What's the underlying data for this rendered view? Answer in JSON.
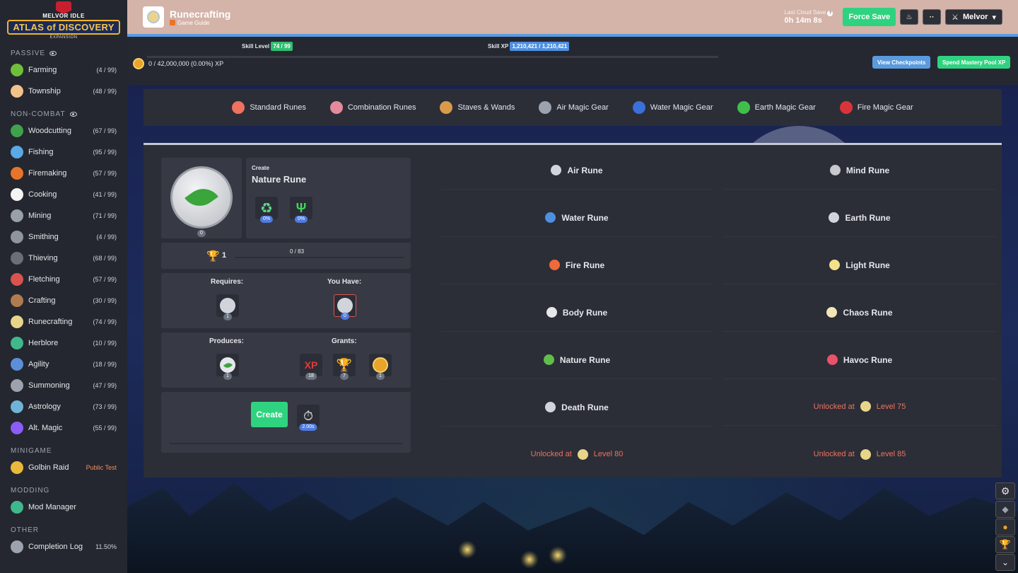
{
  "sidebar": {
    "logo": {
      "top": "MELVOR IDLE",
      "main": "ATLAS of DISCOVERY",
      "sub": "EXPANSION"
    },
    "sections": {
      "passive": "PASSIVE",
      "noncombat": "NON-COMBAT",
      "minigame": "MINIGAME",
      "modding": "MODDING",
      "other": "OTHER"
    },
    "passive_items": [
      {
        "name": "Farming",
        "level": "(4 / 99)",
        "color": "#6fbf3b"
      },
      {
        "name": "Township",
        "level": "(48 / 99)",
        "color": "#f2c28b"
      }
    ],
    "noncombat_items": [
      {
        "name": "Woodcutting",
        "level": "(67 / 99)",
        "color": "#3fa34d"
      },
      {
        "name": "Fishing",
        "level": "(95 / 99)",
        "color": "#5aa9e6"
      },
      {
        "name": "Firemaking",
        "level": "(57 / 99)",
        "color": "#e8742a"
      },
      {
        "name": "Cooking",
        "level": "(41 / 99)",
        "color": "#f4f4f4"
      },
      {
        "name": "Mining",
        "level": "(71 / 99)",
        "color": "#9aa0a8"
      },
      {
        "name": "Smithing",
        "level": "(4 / 99)",
        "color": "#8f959e"
      },
      {
        "name": "Thieving",
        "level": "(68 / 99)",
        "color": "#6b6e78"
      },
      {
        "name": "Fletching",
        "level": "(57 / 99)",
        "color": "#d9534f"
      },
      {
        "name": "Crafting",
        "level": "(30 / 99)",
        "color": "#b07c4f"
      },
      {
        "name": "Runecrafting",
        "level": "(74 / 99)",
        "color": "#e9d58a"
      },
      {
        "name": "Herblore",
        "level": "(10 / 99)",
        "color": "#3fb88c"
      },
      {
        "name": "Agility",
        "level": "(18 / 99)",
        "color": "#5b8fd9"
      },
      {
        "name": "Summoning",
        "level": "(47 / 99)",
        "color": "#9ca3af"
      },
      {
        "name": "Astrology",
        "level": "(73 / 99)",
        "color": "#6fb3d9"
      },
      {
        "name": "Alt. Magic",
        "level": "(55 / 99)",
        "color": "#8b5cf6"
      }
    ],
    "minigame_item": {
      "name": "Golbin Raid",
      "tag": "Public Test"
    },
    "modding_item": {
      "name": "Mod Manager"
    },
    "other_item": {
      "name": "Completion Log",
      "value": "11.50%"
    }
  },
  "header": {
    "title": "Runecrafting",
    "guide": "Game Guide",
    "cloud_label": "Last Cloud Save",
    "cloud_time": "0h 14m 8s",
    "force_save": "Force Save",
    "dots": "··",
    "user": "Melvor"
  },
  "xp": {
    "skill_level_label": "Skill Level",
    "skill_level": "74 / 99",
    "skill_xp_label": "Skill XP",
    "skill_xp": "1,210,421 / 1,210,421",
    "mastery_pool": "0 / 42,000,000 (0.00%) XP",
    "view_checkpoints": "View Checkpoints",
    "spend_mastery": "Spend Mastery Pool XP"
  },
  "tabs": [
    {
      "label": "Standard Runes",
      "color": "#f0715f"
    },
    {
      "label": "Combination Runes",
      "color": "#e58a9c"
    },
    {
      "label": "Staves & Wands",
      "color": "#d99b4a"
    },
    {
      "label": "Air Magic Gear",
      "color": "#9ca3af"
    },
    {
      "label": "Water Magic Gear",
      "color": "#3b6fd9"
    },
    {
      "label": "Earth Magic Gear",
      "color": "#3fbf4a"
    },
    {
      "label": "Fire Magic Gear",
      "color": "#d9343a"
    }
  ],
  "create": {
    "heading": "Create",
    "item": "Nature Rune",
    "item_count": "0",
    "mod1": "0%",
    "mod2": "0%",
    "mastery_level": "1",
    "mastery_progress": "0 / 83",
    "requires": "Requires:",
    "you_have": "You Have:",
    "req_count": "1",
    "have_count": "0",
    "produces": "Produces:",
    "grants": "Grants:",
    "prod_count": "1",
    "xp_text": "XP",
    "xp_count": "18",
    "trophy_count": "7",
    "pool_count": "1",
    "create_btn": "Create",
    "time": "2.00s"
  },
  "runes_left": [
    {
      "name": "Air Rune",
      "color": "#d1d5db"
    },
    {
      "name": "Water Rune",
      "color": "#4f8fe0"
    },
    {
      "name": "Fire Rune",
      "color": "#ef6a3a"
    },
    {
      "name": "Body Rune",
      "color": "#e5e7eb"
    },
    {
      "name": "Nature Rune",
      "color": "#5fbf4a"
    },
    {
      "name": "Death Rune",
      "color": "#d1d5db"
    }
  ],
  "runes_right": [
    {
      "name": "Mind Rune",
      "color": "#c7c9ce"
    },
    {
      "name": "Earth Rune",
      "color": "#d1d5db"
    },
    {
      "name": "Light Rune",
      "color": "#f3e18a"
    },
    {
      "name": "Chaos Rune",
      "color": "#f2e6b8"
    },
    {
      "name": "Havoc Rune",
      "color": "#e8526a"
    }
  ],
  "locked": {
    "r1": {
      "text": "Unlocked at",
      "level": "Level 75"
    },
    "r2": {
      "text": "Unlocked at",
      "level": "Level 80"
    },
    "r3": {
      "text": "Unlocked at",
      "level": "Level 85"
    }
  }
}
